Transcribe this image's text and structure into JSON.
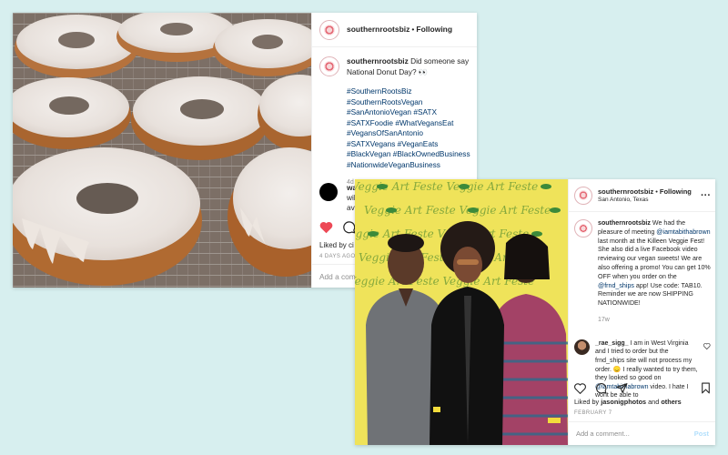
{
  "post1": {
    "username": "southernrootsbiz",
    "follow_label": "Following",
    "caption": "Did someone say National Donut Day? 👀",
    "hashtags": [
      "#SouthernRootsBiz",
      "#SouthernRootsVegan",
      "#SanAntonioVegan #SATX",
      "#SATXFoodie #WhatVegansEat",
      "#VegansOfSanAntonio",
      "#SATXVegans #VeganEats",
      "#BlackVegan #BlackOwnedBusiness",
      "#NationwideVeganBusiness"
    ],
    "age": "4d",
    "comment_user": "wal",
    "comment_line2": "will",
    "comment_line3": "ava",
    "likes_text": "Liked by ci",
    "date": "4 DAYS AGO",
    "add_comment_placeholder": "Add a comm",
    "colors": {
      "heart": "#ed4956"
    }
  },
  "post2": {
    "username": "southernrootsbiz",
    "follow_label": "Following",
    "location": "San Antonio, Texas",
    "caption_lines": [
      "We had the pleasure of meeting",
      "@iamtabithabrown",
      "last month at the Killeen Veggie Fest! She also did a live Facebook video reviewing our vegan sweets! We are also offering a promo! You can get 10% OFF when you order on the",
      "@frnd_ships",
      "app! Use code: TAB10. Reminder we are now SHIPPING NATIONWIDE!"
    ],
    "age": "17w",
    "comment_user": "_rae_sigg_",
    "comment_text_1": "I am in West Virginia and I tried to order but the frnd_ships site will not process my order. 😞 I really wanted to try them, they looked so good on",
    "comment_mention": "@iamtabithabrown",
    "comment_text_2": "video. I hate I wont be able to",
    "likes_prefix": "Liked by",
    "likes_user": "jasonigphotos",
    "likes_and": "and",
    "likes_others": "others",
    "date": "FEBRUARY 7",
    "add_comment_placeholder": "Add a comment...",
    "post_label": "Post",
    "banner_text": "Veggie Art Feste"
  },
  "icons": [
    "heart-icon",
    "comment-icon",
    "share-icon",
    "bookmark-icon",
    "more-icon"
  ]
}
